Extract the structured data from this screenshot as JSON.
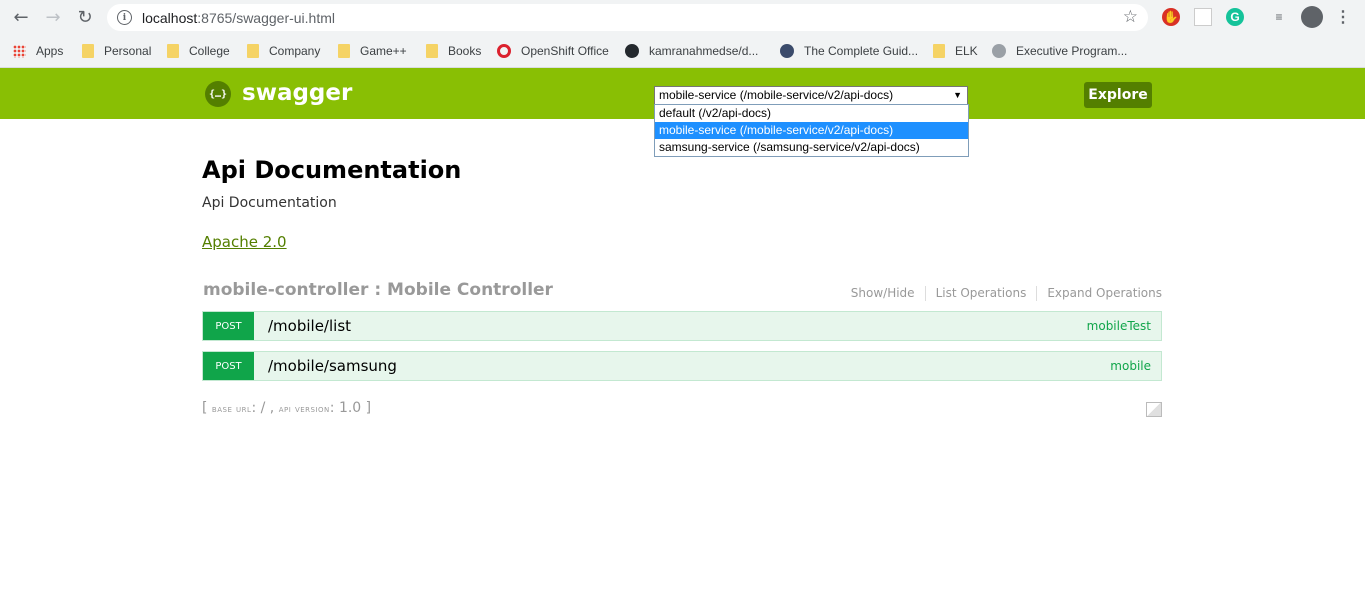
{
  "browser": {
    "url_host": "localhost",
    "url_path": ":8765/swagger-ui.html",
    "icons": [
      "back-icon",
      "forward-icon",
      "reload-icon",
      "info-icon",
      "star-icon",
      "menu-icon"
    ]
  },
  "bookmarks": [
    {
      "label": "Apps",
      "icon": "apps-grid-icon"
    },
    {
      "label": "Personal",
      "icon": "folder-icon"
    },
    {
      "label": "College",
      "icon": "folder-icon"
    },
    {
      "label": "Company",
      "icon": "folder-icon"
    },
    {
      "label": "Game++",
      "icon": "folder-icon"
    },
    {
      "label": "Books",
      "icon": "folder-icon"
    },
    {
      "label": "OpenShift Office",
      "icon": "openshift-icon"
    },
    {
      "label": "kamranahmedse/d...",
      "icon": "github-icon"
    },
    {
      "label": "The Complete Guid...",
      "icon": "site-icon"
    },
    {
      "label": "ELK",
      "icon": "folder-icon"
    },
    {
      "label": "Executive Program...",
      "icon": "site-icon"
    }
  ],
  "swagger": {
    "logo_glyph": "{…}",
    "brand": "swagger",
    "selected_spec": "mobile-service (/mobile-service/v2/api-docs)",
    "spec_options": [
      "default (/v2/api-docs)",
      "mobile-service (/mobile-service/v2/api-docs)",
      "samsung-service (/samsung-service/v2/api-docs)"
    ],
    "explore_label": "Explore",
    "brand_color": "#89bf04"
  },
  "api": {
    "title": "Api Documentation",
    "description": "Api Documentation",
    "license": "Apache 2.0"
  },
  "controller": {
    "title": "mobile-controller : Mobile Controller",
    "show_hide": "Show/Hide",
    "list_operations": "List Operations",
    "expand_operations": "Expand Operations",
    "operations": [
      {
        "method": "POST",
        "path": "/mobile/list",
        "summary": "mobileTest"
      },
      {
        "method": "POST",
        "path": "/mobile/samsung",
        "summary": "mobile"
      }
    ]
  },
  "footer": {
    "open": "[ ",
    "base_url_label": "base url",
    "base_url": ": / , ",
    "api_version_label": "api version",
    "api_version": ": 1.0 ]"
  }
}
